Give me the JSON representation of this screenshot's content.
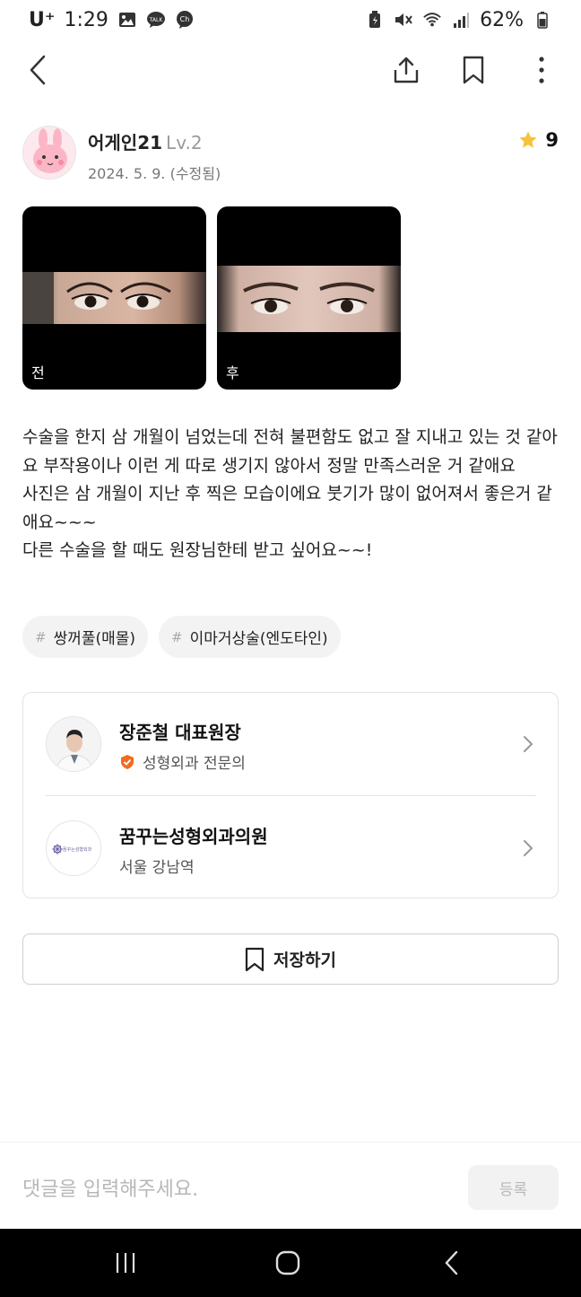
{
  "status_bar": {
    "carrier": "U⁺",
    "time": "1:29",
    "battery": "62%",
    "notification_icons": [
      "image-icon",
      "kakaotalk-icon",
      "channel-icon"
    ],
    "system_icons": [
      "battery-saver-icon",
      "mute-icon",
      "wifi-icon",
      "signal-icon",
      "battery-icon"
    ],
    "talk_badge": "TALK",
    "ch_badge": "Ch"
  },
  "top_bar": {
    "icons": [
      "back-arrow-icon",
      "share-icon",
      "bookmark-icon",
      "more-vertical-icon"
    ]
  },
  "author": {
    "name": "어게인21",
    "level": "Lv.2",
    "date": "2024. 5. 9. (수정됨)",
    "rating": "9"
  },
  "photos": [
    {
      "label": "전"
    },
    {
      "label": "후"
    }
  ],
  "review_text": "수술을 한지 삼 개월이 넘었는데 전혀 불편함도 없고 잘 지내고 있는 것 같아요 부작용이나 이런 게 따로 생기지 않아서 정말 만족스러운 거 같애요\n사진은 삼 개월이 지난 후 찍은 모습이에요 붓기가 많이 없어져서 좋은거 같애요~~~\n다른 수술을 할 때도 원장님한테 받고 싶어요~~!",
  "tags": [
    {
      "hash": "#",
      "label": "쌍꺼풀(매몰)"
    },
    {
      "hash": "#",
      "label": "이마거상술(엔도타인)"
    }
  ],
  "doctor": {
    "name": "장준철 대표원장",
    "specialty": "성형외과 전문의"
  },
  "clinic": {
    "name": "꿈꾸는성형외과의원",
    "location": "서울 강남역",
    "logo_text": "꿈꾸는성형외과"
  },
  "save_button": {
    "label": "저장하기"
  },
  "comment": {
    "placeholder": "댓글을 입력해주세요.",
    "submit_label": "등록"
  },
  "colors": {
    "star": "#f7c23b",
    "specialist_badge": "#f26b21",
    "tag_bg": "#f3f3f3"
  }
}
